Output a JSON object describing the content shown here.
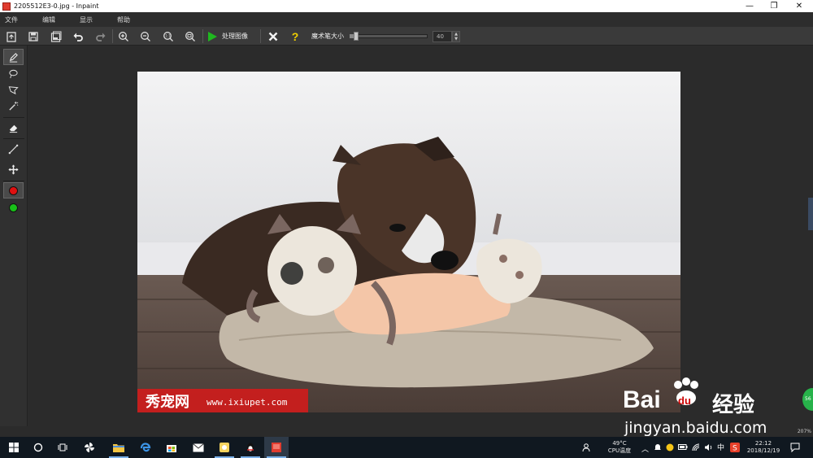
{
  "window": {
    "title": "2205512E3-0.jpg - Inpaint",
    "minimize_glyph": "—",
    "maximize_glyph": "❐",
    "close_glyph": "✕"
  },
  "menu": {
    "items": [
      {
        "label": "文件"
      },
      {
        "label": "编辑"
      },
      {
        "label": "显示"
      },
      {
        "label": "帮助"
      }
    ]
  },
  "toolbar": {
    "process_label": "处理图像",
    "brush_size_label": "魔术笔大小",
    "brush_size_value": "40",
    "brush_size_fraction": 0.05,
    "help_glyph": "?"
  },
  "colors": {
    "red_marker": "#e01010",
    "green_marker": "#18c018",
    "process_play": "#1fb81f",
    "help_yellow": "#f0d000"
  },
  "canvas": {
    "zoom_label": "207%"
  },
  "photo_watermarks": {
    "site_cn": "秀宠网",
    "site_url": "www.ixiupet.com",
    "baidu_brand": "Bai",
    "baidu_paw": "du",
    "baidu_cn": "经验",
    "baidu_url": "jingyan.baidu.com"
  },
  "float_badge": "56",
  "taskbar": {
    "cpu_temp": "49°C",
    "cpu_label": "CPU温度",
    "ime": "中",
    "time": "22:12",
    "date": "2018/12/19"
  }
}
